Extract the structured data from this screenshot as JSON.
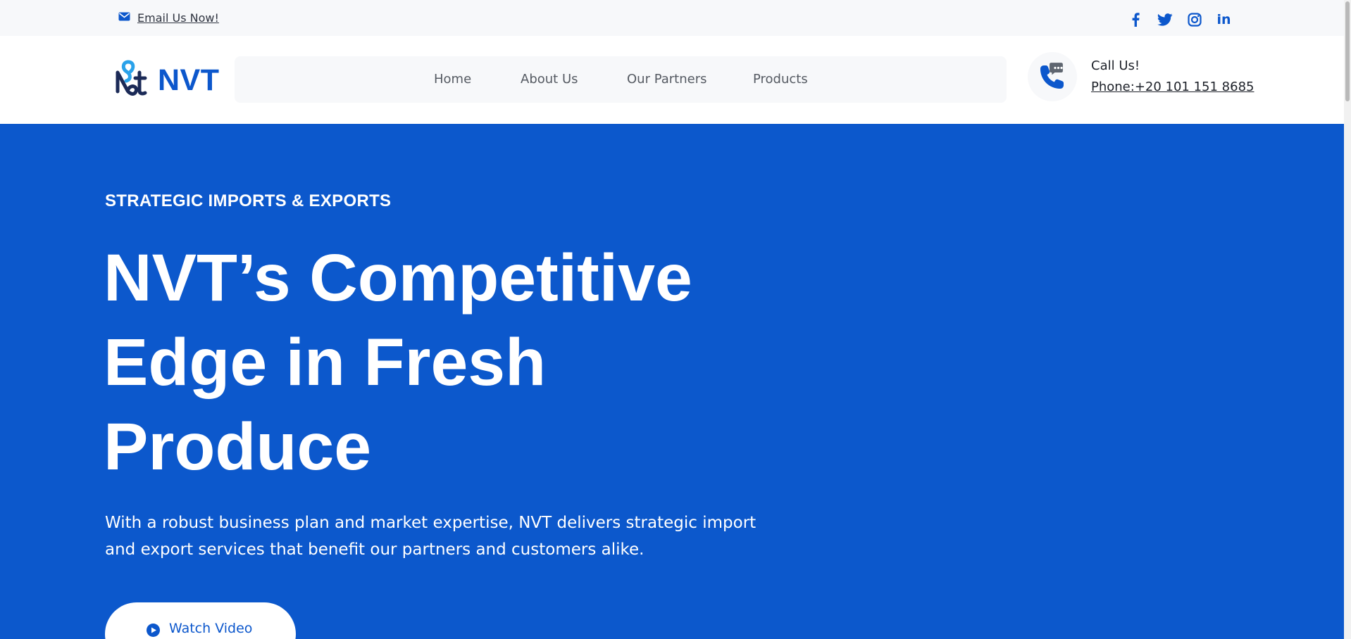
{
  "topbar": {
    "email_label": "Email Us Now!",
    "socials": [
      "facebook-icon",
      "twitter-icon",
      "instagram-icon",
      "linkedin-icon"
    ],
    "linkedin_glyph": "in"
  },
  "header": {
    "logo_text": "NVT",
    "nav": [
      "Home",
      "About Us",
      "Our Partners",
      "Products"
    ],
    "call_label": "Call Us!",
    "phone": "Phone:+20 101 151 8685"
  },
  "hero": {
    "eyebrow": "STRATEGIC IMPORTS & EXPORTS",
    "headline_lines": [
      "NVT’s Competitive",
      "Edge in Fresh",
      "Produce"
    ],
    "subtext": "With a robust business plan and market expertise, NVT delivers strategic import and export services that benefit our partners and customers alike.",
    "cta_label": "Watch Video"
  },
  "colors": {
    "brand_blue": "#0c58cc",
    "light_bg": "#f7f8fa",
    "text_dark": "#1d2129",
    "nav_text": "#555a62"
  }
}
